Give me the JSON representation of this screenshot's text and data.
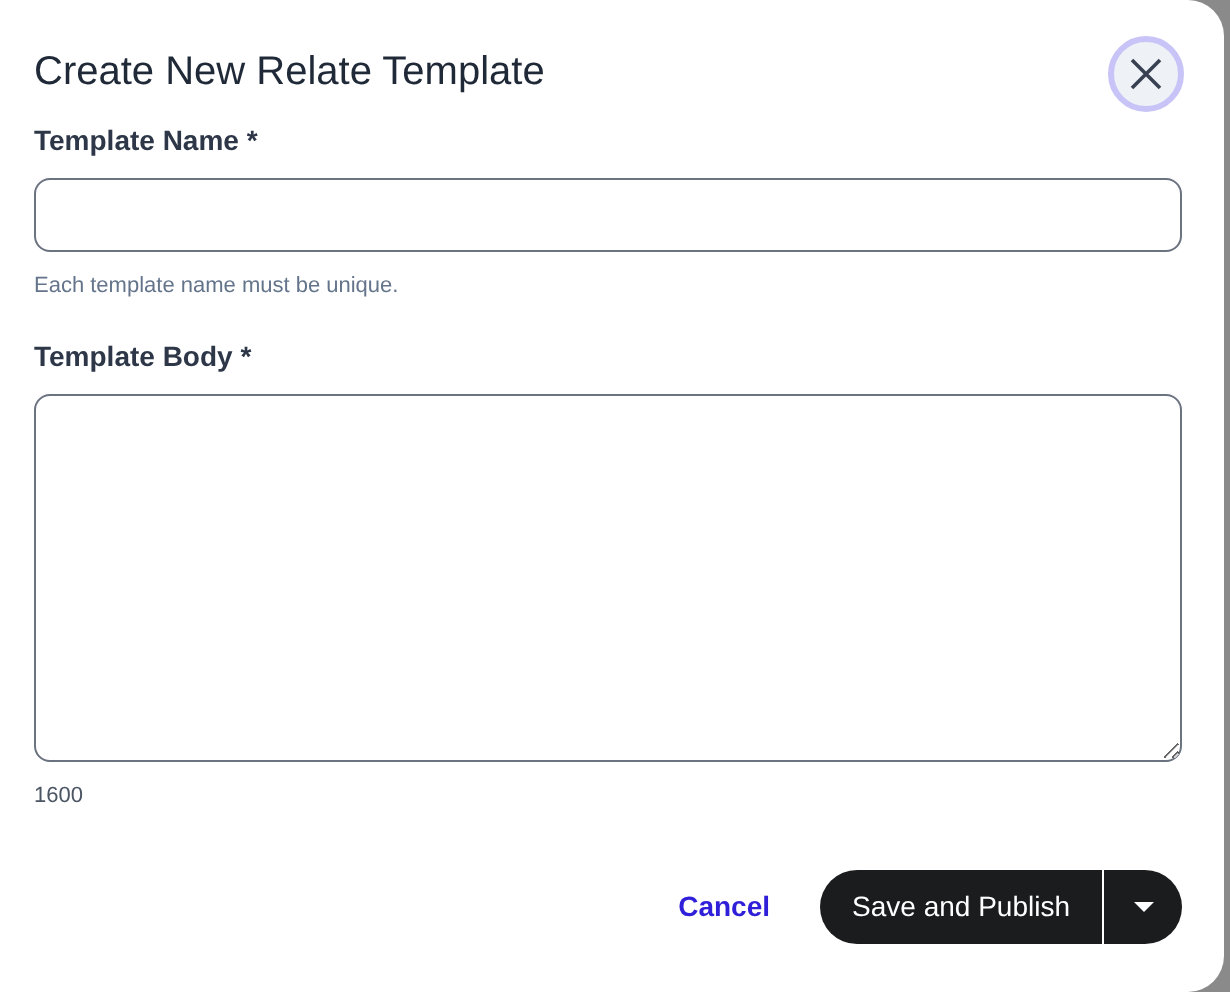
{
  "dialog": {
    "title": "Create New Relate Template"
  },
  "fields": [
    {
      "kind": "input",
      "label": "Template Name *",
      "helper": "Each template name must be unique."
    },
    {
      "kind": "textarea",
      "label": "Template Body *",
      "counter": "1600"
    }
  ],
  "buttons": {
    "cancel": "Cancel",
    "primary": "Save and Publish"
  }
}
